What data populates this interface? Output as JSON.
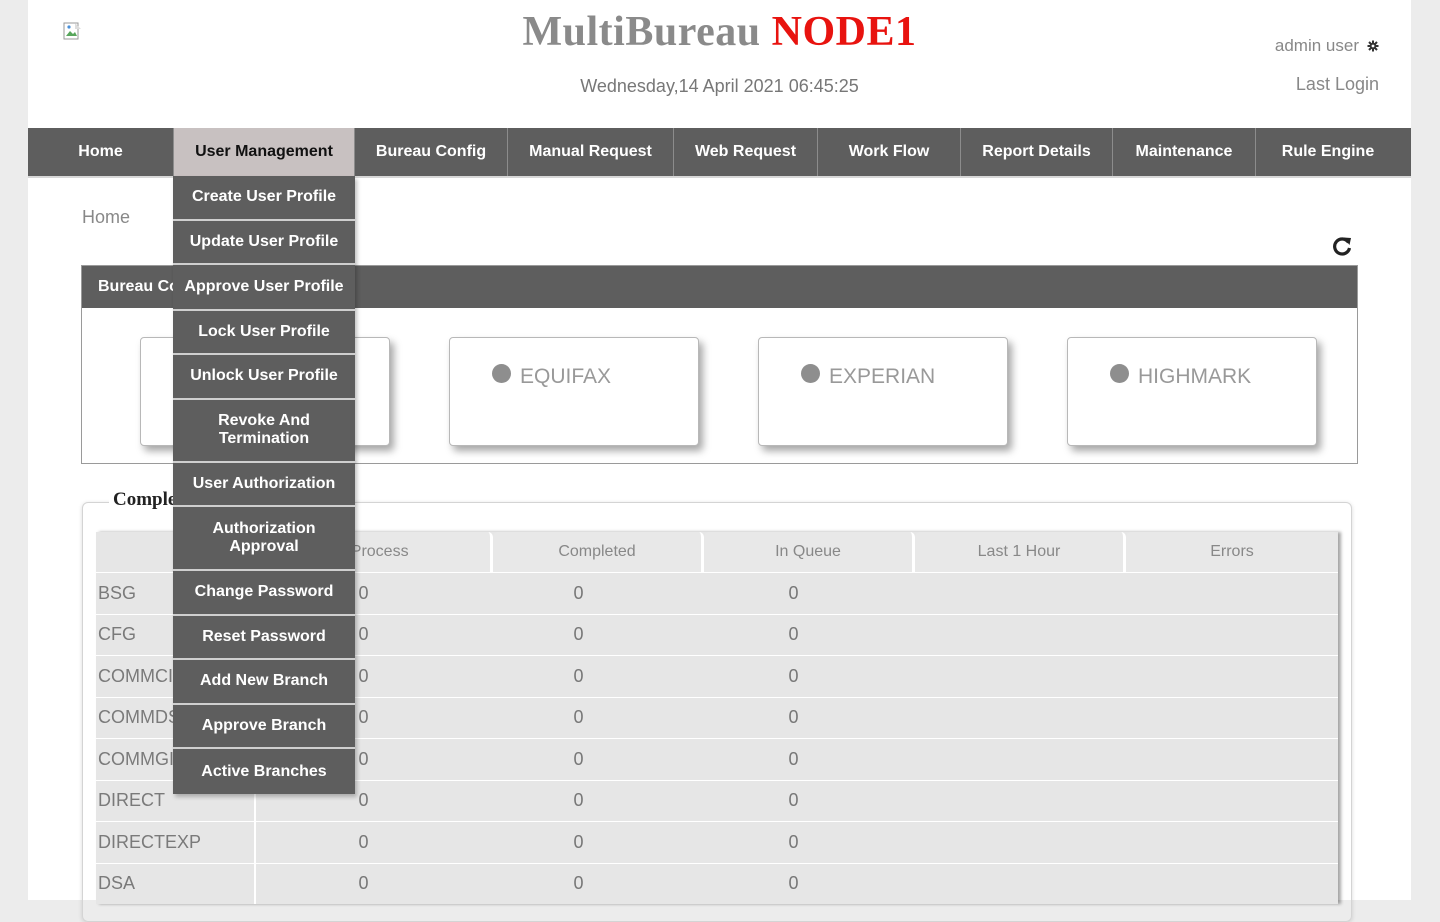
{
  "header": {
    "title_part1": "MultiBureau",
    "title_part2": "NODE1",
    "datetime": "Wednesday,14 April 2021 06:45:25",
    "user_name": "admin user",
    "last_login": "Last Login"
  },
  "nav": {
    "items": [
      {
        "label": "Home"
      },
      {
        "label": "User Management"
      },
      {
        "label": "Bureau Config"
      },
      {
        "label": "Manual Request"
      },
      {
        "label": "Web Request"
      },
      {
        "label": "Work Flow"
      },
      {
        "label": "Report Details"
      },
      {
        "label": "Maintenance"
      },
      {
        "label": "Rule Engine"
      }
    ],
    "active": "User Management"
  },
  "dropdown": {
    "items": [
      {
        "label": "Create User Profile"
      },
      {
        "label": "Update User Profile"
      },
      {
        "label": "Approve User Profile"
      },
      {
        "label": "Lock User Profile"
      },
      {
        "label": "Unlock User Profile"
      },
      {
        "label": "Revoke And\nTermination"
      },
      {
        "label": "User Authorization"
      },
      {
        "label": "Authorization\nApproval"
      },
      {
        "label": "Change Password"
      },
      {
        "label": "Reset Password"
      },
      {
        "label": "Add New Branch"
      },
      {
        "label": "Approve Branch"
      },
      {
        "label": "Active Branches"
      }
    ]
  },
  "breadcrumb": "Home",
  "bureau_panel": {
    "header": "Bureau Co",
    "cards": [
      {
        "name": ""
      },
      {
        "name": "EQUIFAX"
      },
      {
        "name": "EXPERIAN"
      },
      {
        "name": "HIGHMARK"
      }
    ]
  },
  "completion_panel": {
    "legend": "Comple",
    "columns": [
      "n Process",
      "Completed",
      "In Queue",
      "Last 1 Hour",
      "Errors"
    ],
    "rows": [
      {
        "name": "BSG",
        "in_process": "0",
        "completed": "0",
        "in_queue": "0"
      },
      {
        "name": "CFG",
        "in_process": "0",
        "completed": "0",
        "in_queue": "0"
      },
      {
        "name": "COMMCI",
        "in_process": "0",
        "completed": "0",
        "in_queue": "0"
      },
      {
        "name": "COMMDS",
        "in_process": "0",
        "completed": "0",
        "in_queue": "0"
      },
      {
        "name": "COMMGI",
        "in_process": "0",
        "completed": "0",
        "in_queue": "0"
      },
      {
        "name": "DIRECT",
        "in_process": "0",
        "completed": "0",
        "in_queue": "0"
      },
      {
        "name": "DIRECTEXP",
        "in_process": "0",
        "completed": "0",
        "in_queue": "0"
      },
      {
        "name": "DSA",
        "in_process": "0",
        "completed": "0",
        "in_queue": "0"
      }
    ]
  },
  "colors": {
    "nav_bg": "#5e5e5e",
    "nav_active_bg": "#c8c1c1",
    "title_gray": "#8a8a8a",
    "title_red": "#e8130f"
  }
}
